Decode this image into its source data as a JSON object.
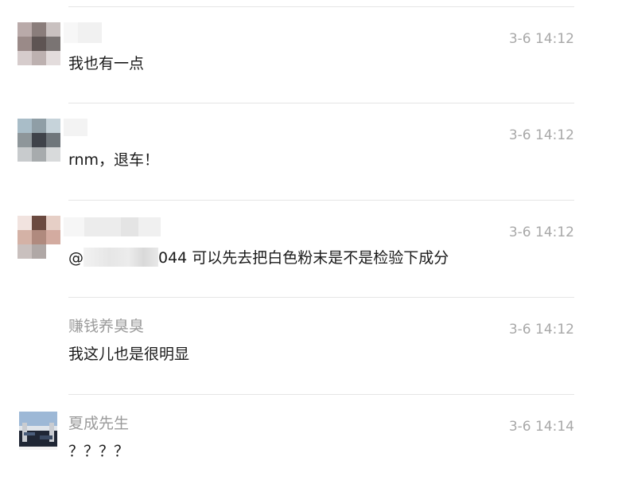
{
  "comments": [
    {
      "username": "",
      "time": "3-6 14:12",
      "text": "我也有一点",
      "avatar_colors": [
        "#b9aaa9",
        "#8a7d7b",
        "#c9c1c0",
        "#9a8a88",
        "#5e5453",
        "#7a7473",
        "#d6cccc",
        "#bdb1b0",
        "#e3dcdc"
      ]
    },
    {
      "username": "",
      "time": "3-6 14:12",
      "text": "rnm，退车！",
      "avatar_colors": [
        "#a9bdc8",
        "#8f9ea6",
        "#c6d3da",
        "#8e969a",
        "#3f434a",
        "#6f767b",
        "#c8cbcd",
        "#a7abad",
        "#d8dadb"
      ]
    },
    {
      "username": "",
      "time": "3-6 14:12",
      "text_prefix": "@",
      "text_suffix": "044 可以先去把白色粉末是不是检验下成分",
      "avatar_colors": [
        "#f1e3df",
        "#6b4a40",
        "#e6cfc6",
        "#d4b2a6",
        "#b08a7e",
        "#d3aba0",
        "#c9c0be",
        "#b0a8a6",
        "#ffffff"
      ]
    },
    {
      "username": "赚钱养臭臭",
      "time": "3-6 14:12",
      "text": "我这儿也是很明显"
    },
    {
      "username": "夏成先生",
      "time": "3-6 14:14",
      "text": "？？？？",
      "avatar_colors": [
        "#6f8fb5",
        "#d8dde3",
        "#2a3140"
      ]
    }
  ]
}
